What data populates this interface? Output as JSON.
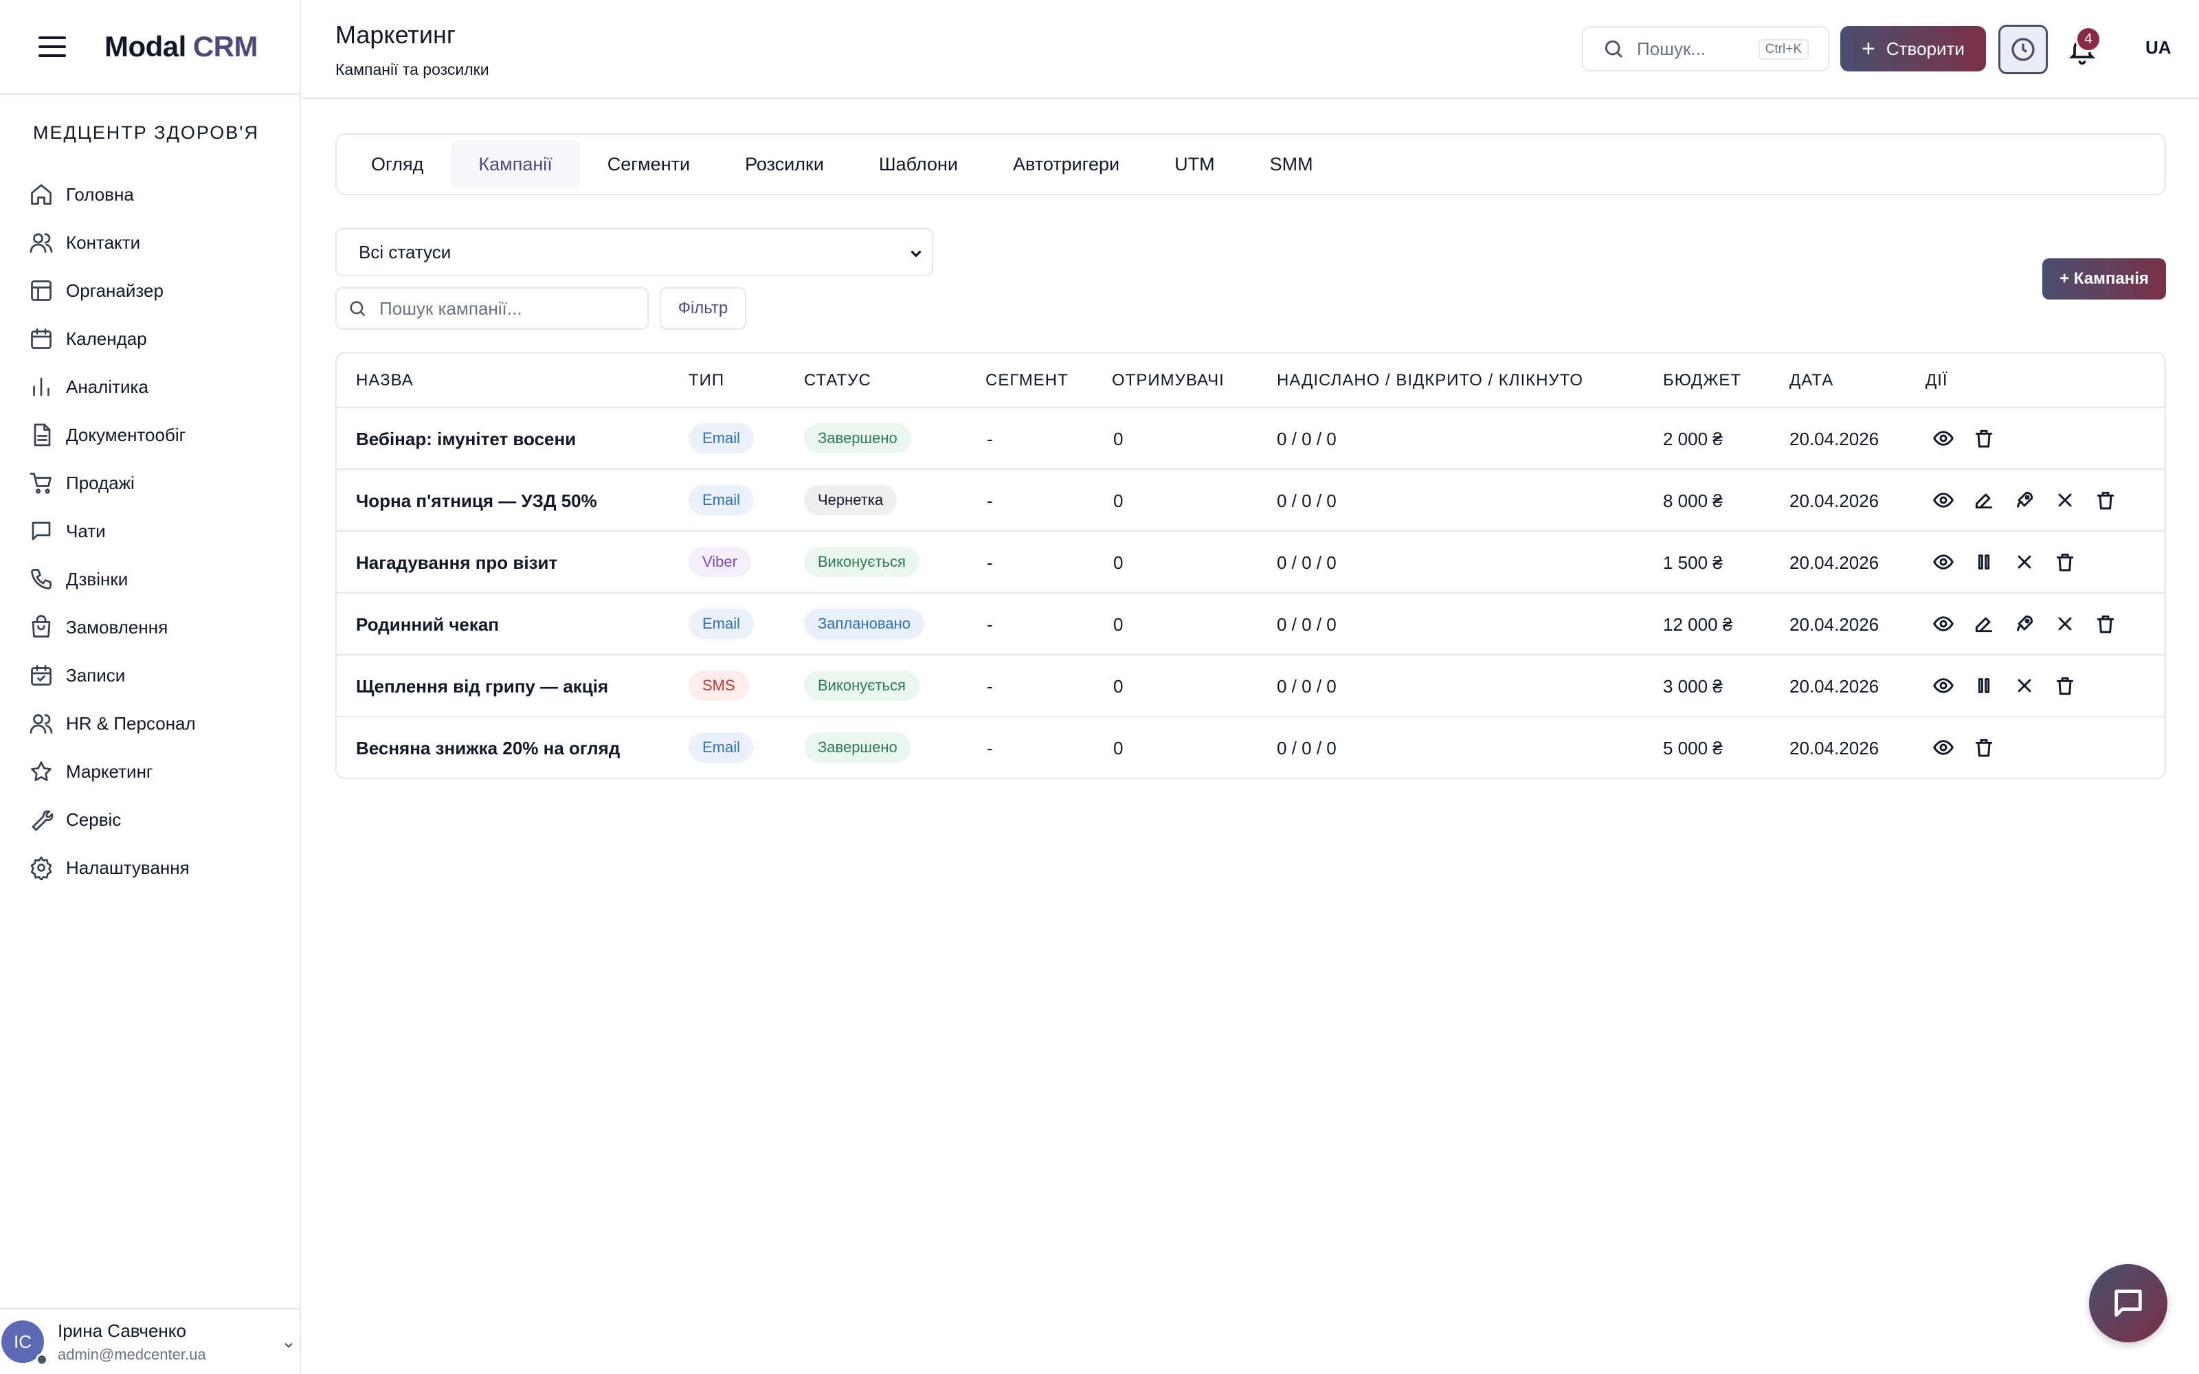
{
  "app": {
    "logo_main": "Modal",
    "logo_accent": "CRM",
    "org_name": "МЕДЦЕНТР ЗДОРОВ'Я"
  },
  "sidebar": {
    "items": [
      {
        "label": "Головна",
        "icon": "home-icon"
      },
      {
        "label": "Контакти",
        "icon": "users-icon"
      },
      {
        "label": "Органайзер",
        "icon": "layout-icon"
      },
      {
        "label": "Календар",
        "icon": "calendar-icon"
      },
      {
        "label": "Аналітика",
        "icon": "bar-chart-icon"
      },
      {
        "label": "Документообіг",
        "icon": "file-icon"
      },
      {
        "label": "Продажі",
        "icon": "cart-icon"
      },
      {
        "label": "Чати",
        "icon": "chat-icon"
      },
      {
        "label": "Дзвінки",
        "icon": "phone-icon"
      },
      {
        "label": "Замовлення",
        "icon": "bag-icon"
      },
      {
        "label": "Записи",
        "icon": "calendar-check-icon"
      },
      {
        "label": "HR & Персонал",
        "icon": "users-icon"
      },
      {
        "label": "Маркетинг",
        "icon": "star-icon"
      },
      {
        "label": "Сервіс",
        "icon": "wrench-icon"
      },
      {
        "label": "Налаштування",
        "icon": "gear-icon"
      }
    ]
  },
  "user": {
    "initials": "ІС",
    "name": "Ірина Савченко",
    "email": "admin@medcenter.ua"
  },
  "header": {
    "title": "Маркетинг",
    "subtitle": "Кампанії та розсилки",
    "search_placeholder": "Пошук...",
    "search_shortcut": "Ctrl+K",
    "create_label": "Створити",
    "notifications_count": "4",
    "language": "UA"
  },
  "tabs": [
    {
      "label": "Огляд",
      "active": false
    },
    {
      "label": "Кампанії",
      "active": true
    },
    {
      "label": "Сегменти",
      "active": false
    },
    {
      "label": "Розсилки",
      "active": false
    },
    {
      "label": "Шаблони",
      "active": false
    },
    {
      "label": "Автотригери",
      "active": false
    },
    {
      "label": "UTM",
      "active": false
    },
    {
      "label": "SMM",
      "active": false
    }
  ],
  "filters": {
    "status_selected": "Всі статуси",
    "search_placeholder": "Пошук кампанії...",
    "filter_label": "Фільтр",
    "add_campaign_label": "+ Кампанія"
  },
  "table": {
    "columns": {
      "name": "НАЗВА",
      "type": "ТИП",
      "status": "СТАТУС",
      "segment": "СЕГМЕНТ",
      "recipients": "ОТРИМУВАЧІ",
      "stats": "НАДІСЛАНО / ВІДКРИТО / КЛІКНУТО",
      "budget": "БЮДЖЕТ",
      "date": "ДАТА",
      "actions": "ДІЇ"
    },
    "rows": [
      {
        "name": "Вебінар: імунітет восени",
        "type": "Email",
        "status": "Завершено",
        "segment": "-",
        "recipients": "0",
        "stats": "0 / 0 / 0",
        "budget": "2 000 ₴",
        "date": "20.04.2026"
      },
      {
        "name": "Чорна п'ятниця — УЗД 50%",
        "type": "Email",
        "status": "Чернетка",
        "segment": "-",
        "recipients": "0",
        "stats": "0 / 0 / 0",
        "budget": "8 000 ₴",
        "date": "20.04.2026"
      },
      {
        "name": "Нагадування про візит",
        "type": "Viber",
        "status": "Виконується",
        "segment": "-",
        "recipients": "0",
        "stats": "0 / 0 / 0",
        "budget": "1 500 ₴",
        "date": "20.04.2026"
      },
      {
        "name": "Родинний чекап",
        "type": "Email",
        "status": "Заплановано",
        "segment": "-",
        "recipients": "0",
        "stats": "0 / 0 / 0",
        "budget": "12 000 ₴",
        "date": "20.04.2026"
      },
      {
        "name": "Щеплення від грипу — акція",
        "type": "SMS",
        "status": "Виконується",
        "segment": "-",
        "recipients": "0",
        "stats": "0 / 0 / 0",
        "budget": "3 000 ₴",
        "date": "20.04.2026"
      },
      {
        "name": "Весняна знижка 20% на огляд",
        "type": "Email",
        "status": "Завершено",
        "segment": "-",
        "recipients": "0",
        "stats": "0 / 0 / 0",
        "budget": "5 000 ₴",
        "date": "20.04.2026"
      }
    ]
  },
  "colors": {
    "accent": "#4b4a7a",
    "gradient_start": "#48506f",
    "gradient_end": "#7a3147",
    "badge_email_bg": "#eaf1fb",
    "badge_email_text": "#2f6fb8",
    "badge_viber_bg": "#f3eefb",
    "badge_viber_text": "#7a4bb8",
    "badge_sms_bg": "#fdecec",
    "badge_sms_text": "#c0392b",
    "status_done_bg": "#eaf7ef",
    "status_done_text": "#2d7a4f",
    "status_draft_bg": "#efefef",
    "status_draft_text": "#111827",
    "status_running_bg": "#eaf7ef",
    "status_running_text": "#2d7a4f",
    "status_planned_bg": "#e8f1fb",
    "status_planned_text": "#2f6fb8"
  }
}
